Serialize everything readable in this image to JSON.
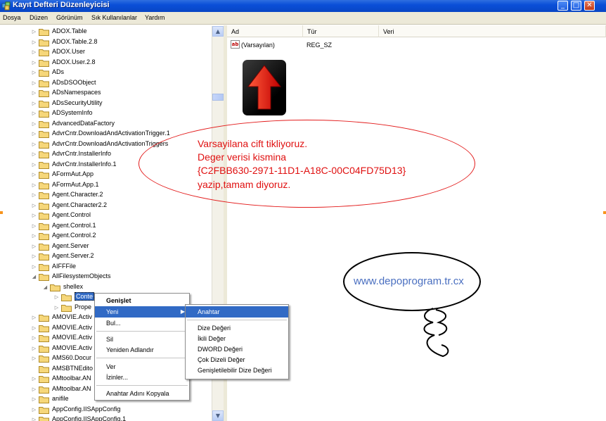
{
  "window": {
    "title": "Kayıt Defteri Düzenleyicisi",
    "buttons": {
      "minimize": "_",
      "maximize": "□",
      "close": "✕"
    }
  },
  "menubar": [
    "Dosya",
    "Düzen",
    "Görünüm",
    "Sık Kullanılanlar",
    "Yardım"
  ],
  "tree": {
    "items": [
      {
        "label": "ADOX.Table"
      },
      {
        "label": "ADOX.Table.2.8"
      },
      {
        "label": "ADOX.User"
      },
      {
        "label": "ADOX.User.2.8"
      },
      {
        "label": "ADs"
      },
      {
        "label": "ADsDSOObject"
      },
      {
        "label": "ADsNamespaces"
      },
      {
        "label": "ADsSecurityUtility"
      },
      {
        "label": "ADSystemInfo"
      },
      {
        "label": "AdvancedDataFactory"
      },
      {
        "label": "AdvrCntr.DownloadAndActivationTrigger.1"
      },
      {
        "label": "AdvrCntr.DownloadAndActivationTriggers"
      },
      {
        "label": "AdvrCntr.InstallerInfo"
      },
      {
        "label": "AdvrCntr.InstallerInfo.1"
      },
      {
        "label": "AFormAut.App"
      },
      {
        "label": "AFormAut.App.1"
      },
      {
        "label": "Agent.Character.2"
      },
      {
        "label": "Agent.Character2.2"
      },
      {
        "label": "Agent.Control"
      },
      {
        "label": "Agent.Control.1"
      },
      {
        "label": "Agent.Control.2"
      },
      {
        "label": "Agent.Server"
      },
      {
        "label": "Agent.Server.2"
      },
      {
        "label": "AIFFFile"
      },
      {
        "label": "AllFilesystemObjects"
      },
      {
        "label": "shellex"
      },
      {
        "label": "Conte"
      },
      {
        "label": "Prope"
      },
      {
        "label": "AMOVIE.Activ"
      },
      {
        "label": "AMOVIE.Activ"
      },
      {
        "label": "AMOVIE.Activ"
      },
      {
        "label": "AMOVIE.Activ"
      },
      {
        "label": "AMS60.Docur"
      },
      {
        "label": "AMSBTNEdito"
      },
      {
        "label": "AMtoolbar.AN"
      },
      {
        "label": "AMtoolbar.AN"
      },
      {
        "label": "anifile"
      },
      {
        "label": "AppConfig.IISAppConfig"
      },
      {
        "label": "AppConfig.IISAppConfig.1"
      }
    ]
  },
  "list": {
    "headers": {
      "name": "Ad",
      "type": "Tür",
      "data": "Veri"
    },
    "rows": [
      {
        "name": "(Varsayılan)",
        "type": "REG_SZ",
        "data": ""
      }
    ]
  },
  "annotation": {
    "lines": [
      "Varsayilana cift tikliyoruz.",
      "Deger verisi kismina",
      "{C2FBB630-2971-11D1-A18C-00C04FD75D13}",
      "yazip,tamam diyoruz."
    ],
    "color": "#e01010"
  },
  "watermark": {
    "text": "www.depoprogram.tr.cx",
    "color": "#4a6fc0"
  },
  "context_menu": {
    "items": [
      "Genişlet",
      "Yeni",
      "Bul...",
      "Sil",
      "Yeniden Adlandır",
      "Ver",
      "İzinler...",
      "Anahtar Adını Kopyala"
    ]
  },
  "submenu": {
    "items": [
      "Anahtar",
      "Dize Değeri",
      "İkili Değer",
      "DWORD Değeri",
      "Çok Dizeli Değer",
      "Genişletilebilir Dize Değeri"
    ]
  },
  "icons": {
    "app": "registry-icon",
    "folder": "folder-icon",
    "value": "string-value-icon",
    "arrow": "red-up-arrow-icon"
  },
  "colors": {
    "titlebar": "#0a4fd8",
    "selection": "#316ac5",
    "annotation": "#e31b1b"
  }
}
